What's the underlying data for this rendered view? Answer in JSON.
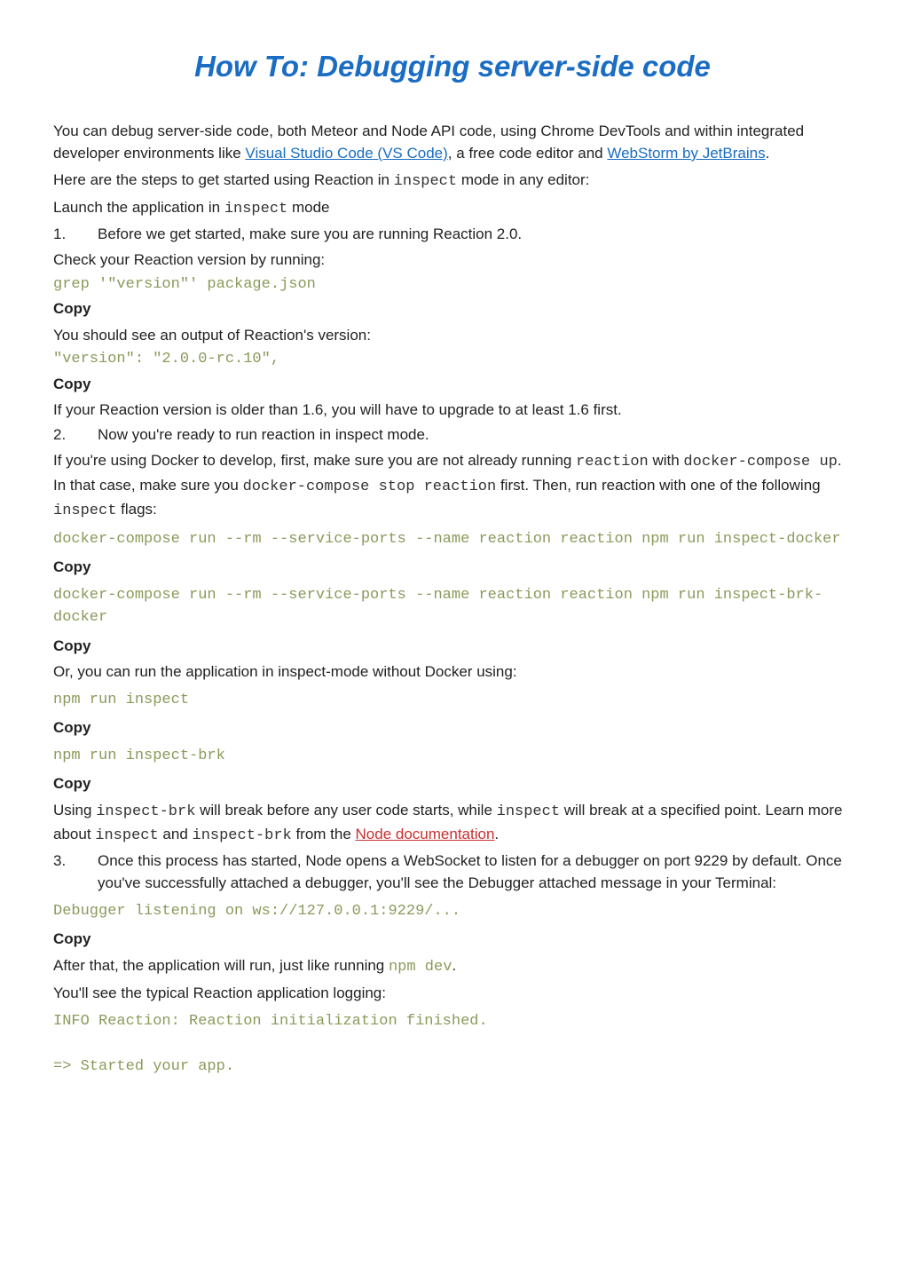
{
  "title": "How To: Debugging server-side code",
  "intro": {
    "p1_a": "You can debug server-side code, both Meteor and Node API code, using Chrome DevTools and within integrated developer environments like ",
    "link1": "Visual Studio Code (VS Code)",
    "p1_b": ", a free code editor and ",
    "link2": "WebStorm by JetBrains",
    "p1_c": ".",
    "p2_a": "Here are the steps to get started using Reaction in ",
    "p2_mono1": "inspect",
    "p2_b": " mode in any editor:",
    "p3_a": "Launch the application in ",
    "p3_mono1": "inspect",
    "p3_b": " mode"
  },
  "step1": {
    "num": "1.",
    "text": "Before we get started, make sure you are running Reaction 2.0.",
    "hint": "Check your Reaction version by running:",
    "code": "grep '\"version\"' package.json",
    "copy": "Copy",
    "result": "You should see an output of Reaction's version:",
    "code2": "\"version\": \"2.0.0-rc.10\",",
    "copy2": "Copy",
    "upgrade": "If your Reaction version is older than 1.6, you will have to upgrade to at least 1.6 first."
  },
  "step2": {
    "num": "2.",
    "text": "Now you're ready to run reaction in inspect mode.",
    "hint": "If you're using Docker to develop, first, make sure you are not already running ",
    "mono1": "reaction",
    "hint2": " with ",
    "mono2": "docker-compose up",
    "hint3": ". In that case, make sure you ",
    "mono3": "docker-compose stop reaction",
    "hint4": " first. Then, run reaction with one of the following ",
    "mono4": "inspect",
    "hint5": " flags:",
    "codeA": "docker-compose run --rm --service-ports --name reaction reaction npm run inspect-docker",
    "copyA": "Copy",
    "codeB": "docker-compose run --rm --service-ports --name reaction reaction npm run inspect-brk-docker",
    "copyB": "Copy",
    "or": "Or, you can run the application in inspect-mode without Docker using:",
    "codeC": "npm run inspect",
    "copyC": "Copy",
    "codeD": "npm run inspect-brk",
    "copyD": "Copy",
    "tail_a": "Using ",
    "tail_mono1": "inspect-brk",
    "tail_b": " will break before any user code starts, while ",
    "tail_mono2": "inspect",
    "tail_c": " will break at a specified point. Learn more about ",
    "tail_mono3": "inspect",
    "tail_d": " and ",
    "tail_mono4": "inspect-brk",
    "tail_e": " from the ",
    "tail_link": "Node documentation",
    "tail_f": "."
  },
  "step3": {
    "num": "3.",
    "text": "Once this process has started, Node opens a WebSocket to listen for a debugger on port 9229 by default. Once you've successfully attached a debugger, you'll see the Debugger attached message in your Terminal:",
    "codeA": "Debugger listening on ws://127.0.0.1:9229/...",
    "copyA": "Copy",
    "after_a": "After that, the application will run, just like running ",
    "after_mono": "npm dev",
    "after_b": ".",
    "logging": "You'll see the typical Reaction application logging:",
    "codeB": "INFO Reaction: Reaction initialization finished.\n\n=> Started your app."
  }
}
